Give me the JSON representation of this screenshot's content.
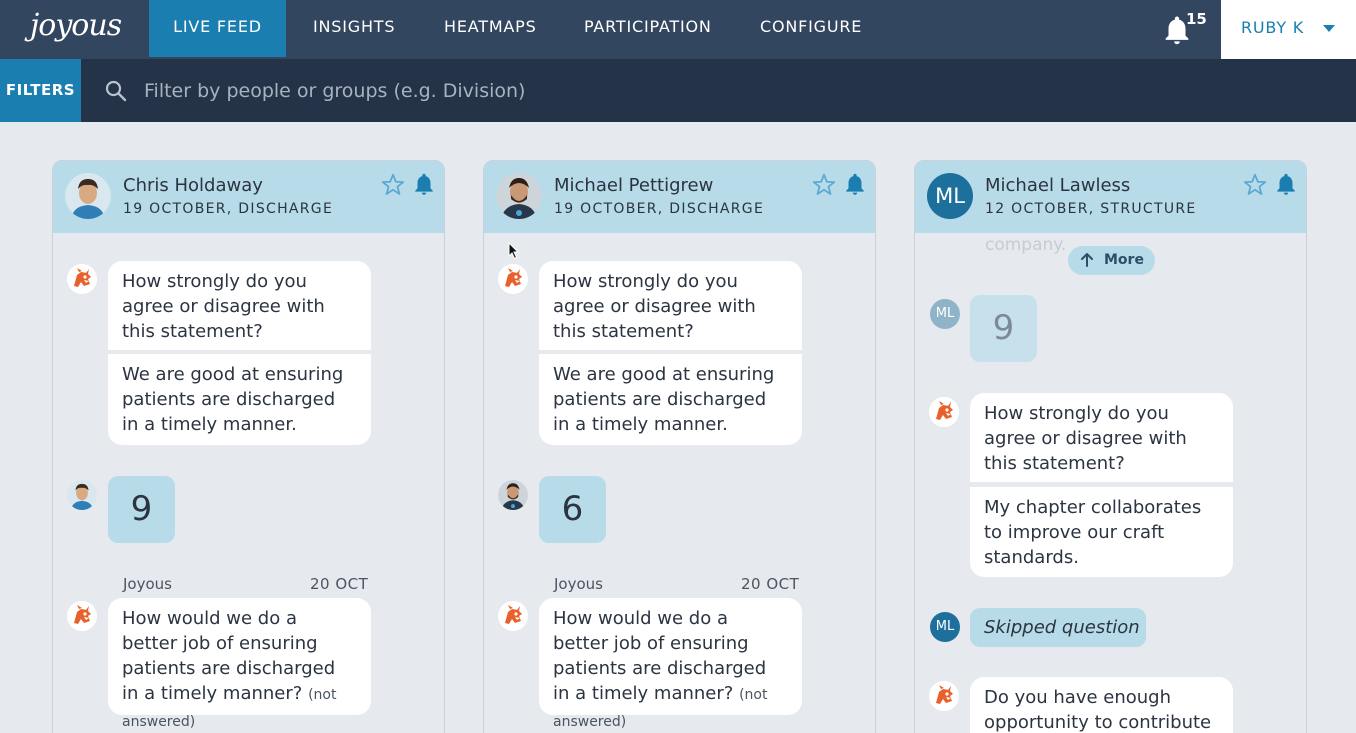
{
  "app": {
    "logo": "joyous"
  },
  "nav": {
    "items": [
      {
        "label": "LIVE FEED",
        "active": true
      },
      {
        "label": "INSIGHTS"
      },
      {
        "label": "HEATMAPS"
      },
      {
        "label": "PARTICIPATION"
      },
      {
        "label": "CONFIGURE"
      }
    ],
    "notifications_count": "15",
    "user_label": "RUBY K"
  },
  "filters": {
    "button_label": "FILTERS",
    "search_placeholder": "Filter by people or groups (e.g. Division)"
  },
  "colors": {
    "nav_bg": "#33465f",
    "accent": "#1a7fb0",
    "filter_bg": "#243348",
    "header_bg": "#b7dbe9",
    "page_bg": "#e6e9ee"
  },
  "columns": [
    {
      "name": "Chris Holdaway",
      "subtitle": "19 OCTOBER, DISCHARGE",
      "question_prompt": "How strongly do you agree or disagree with this statement?",
      "statement": "We are good at ensuring patients are discharged in a timely manner.",
      "score": "9",
      "sender": "Joyous",
      "date": "20 OCT",
      "followup": "How would we do a better job of ensuring patients are discharged in a timely manner?",
      "followup_status": "(not answered)"
    },
    {
      "name": "Michael Pettigrew",
      "subtitle": "19 OCTOBER, DISCHARGE",
      "question_prompt": "How strongly do you agree or disagree with this statement?",
      "statement": "We are good at ensuring patients are discharged in a timely manner.",
      "score": "6",
      "sender": "Joyous",
      "date": "20 OCT",
      "followup": "How would we do a better job of ensuring patients are discharged in a timely manner?",
      "followup_status": "(not answered)"
    },
    {
      "name": "Michael Lawless",
      "initials": "ML",
      "subtitle": "12 OCTOBER, STRUCTURE",
      "ghost_text": "company.",
      "more_label": "More",
      "score": "9",
      "question_prompt": "How strongly do you agree or disagree with this statement?",
      "statement": "My chapter collaborates to improve our craft standards.",
      "skipped_label": "Skipped question",
      "next_question": "Do you have enough opportunity to contribute"
    }
  ]
}
